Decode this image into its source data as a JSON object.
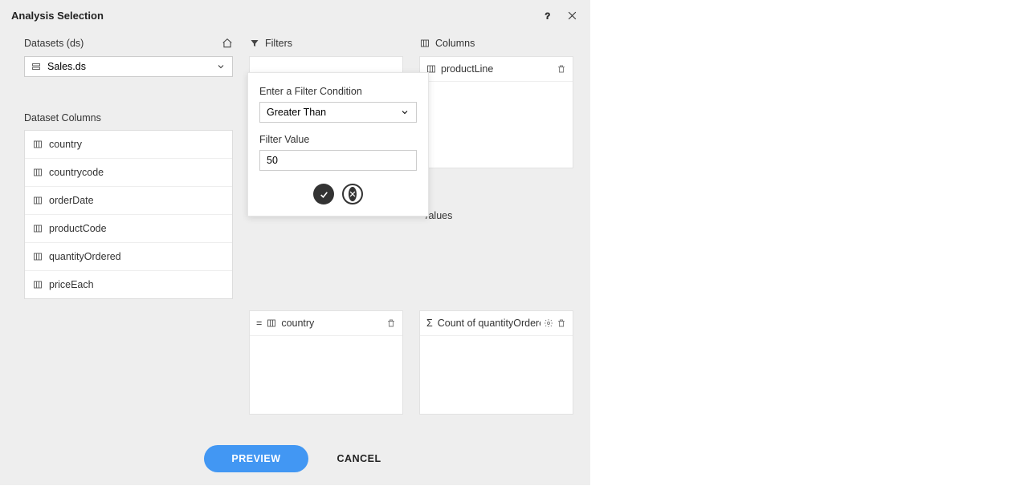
{
  "header": {
    "title": "Analysis Selection"
  },
  "datasets": {
    "label": "Datasets (ds)",
    "selected": "Sales.ds"
  },
  "datasetColumns": {
    "label": "Dataset Columns",
    "items": [
      "country",
      "countrycode",
      "orderDate",
      "productCode",
      "quantityOrdered",
      "priceEach"
    ]
  },
  "filters": {
    "label": "Filters",
    "popup": {
      "conditionLabel": "Enter a Filter Condition",
      "conditionSelected": "Greater Than",
      "valueLabel": "Filter Value",
      "value": "50"
    }
  },
  "columns": {
    "label": "Columns",
    "items": [
      "productLine"
    ]
  },
  "rows": {
    "prefix": "=",
    "items": [
      "country"
    ]
  },
  "values": {
    "labelPartial": "/alues",
    "prefix": "Σ",
    "items": [
      "Count of quantityOrdered"
    ]
  },
  "buttons": {
    "preview": "PREVIEW",
    "cancel": "CANCEL"
  }
}
